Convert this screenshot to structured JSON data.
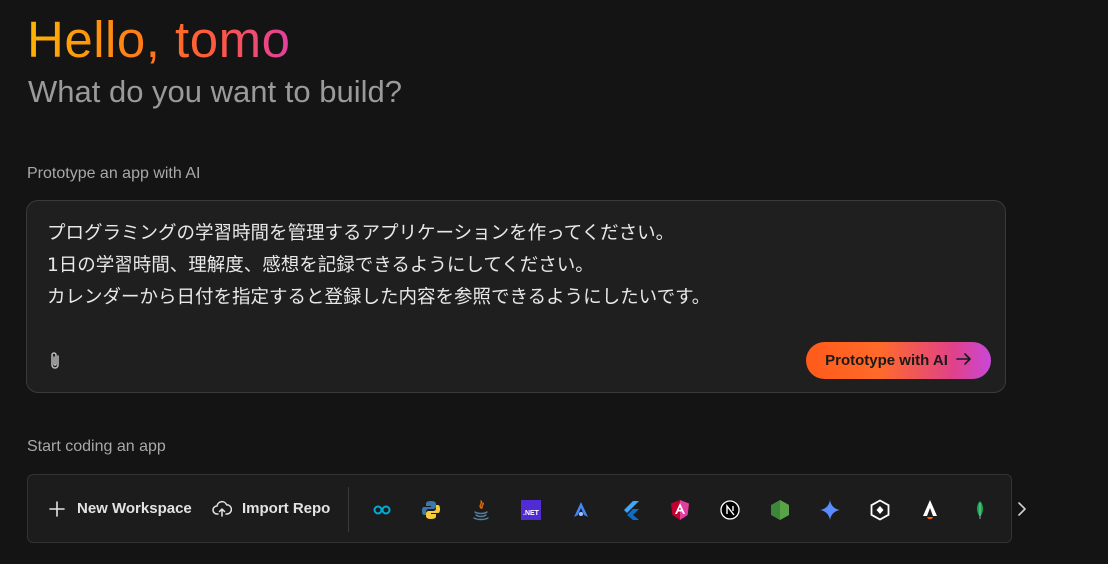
{
  "header": {
    "greeting": "Hello, tomo",
    "subtitle": "What do you want to build?"
  },
  "prototype": {
    "section_label": "Prototype an app with AI",
    "prompt_lines": [
      "プログラミングの学習時間を管理するアプリケーションを作ってください。",
      "1日の学習時間、理解度、感想を記録できるようにしてください。",
      "カレンダーから日付を指定すると登録した内容を参照できるようにしたいです。"
    ],
    "attach_icon": "paperclip-icon",
    "button_label": "Prototype with AI",
    "button_icon": "arrow-right-icon",
    "button_gradient": [
      "#ff5a1a",
      "#e0418a",
      "#c848d8"
    ]
  },
  "coding": {
    "section_label": "Start coding an app",
    "new_workspace_label": "New Workspace",
    "import_repo_label": "Import Repo",
    "templates": [
      "go-icon",
      "python-icon",
      "java-icon",
      "dotnet-icon",
      "astro-icon",
      "flutter-icon",
      "angular-icon",
      "nextjs-icon",
      "nodejs-icon",
      "gemini-icon",
      "hexagon-icon",
      "astro-a-icon",
      "mongodb-icon"
    ],
    "dotnet_label": ".NET",
    "next_icon": "chevron-right-icon"
  },
  "colors": {
    "background": "#141414",
    "panel": "#1f1f1f",
    "greeting_gradient": [
      "#ffb300",
      "#ff7a1a",
      "#e23fa0"
    ]
  }
}
